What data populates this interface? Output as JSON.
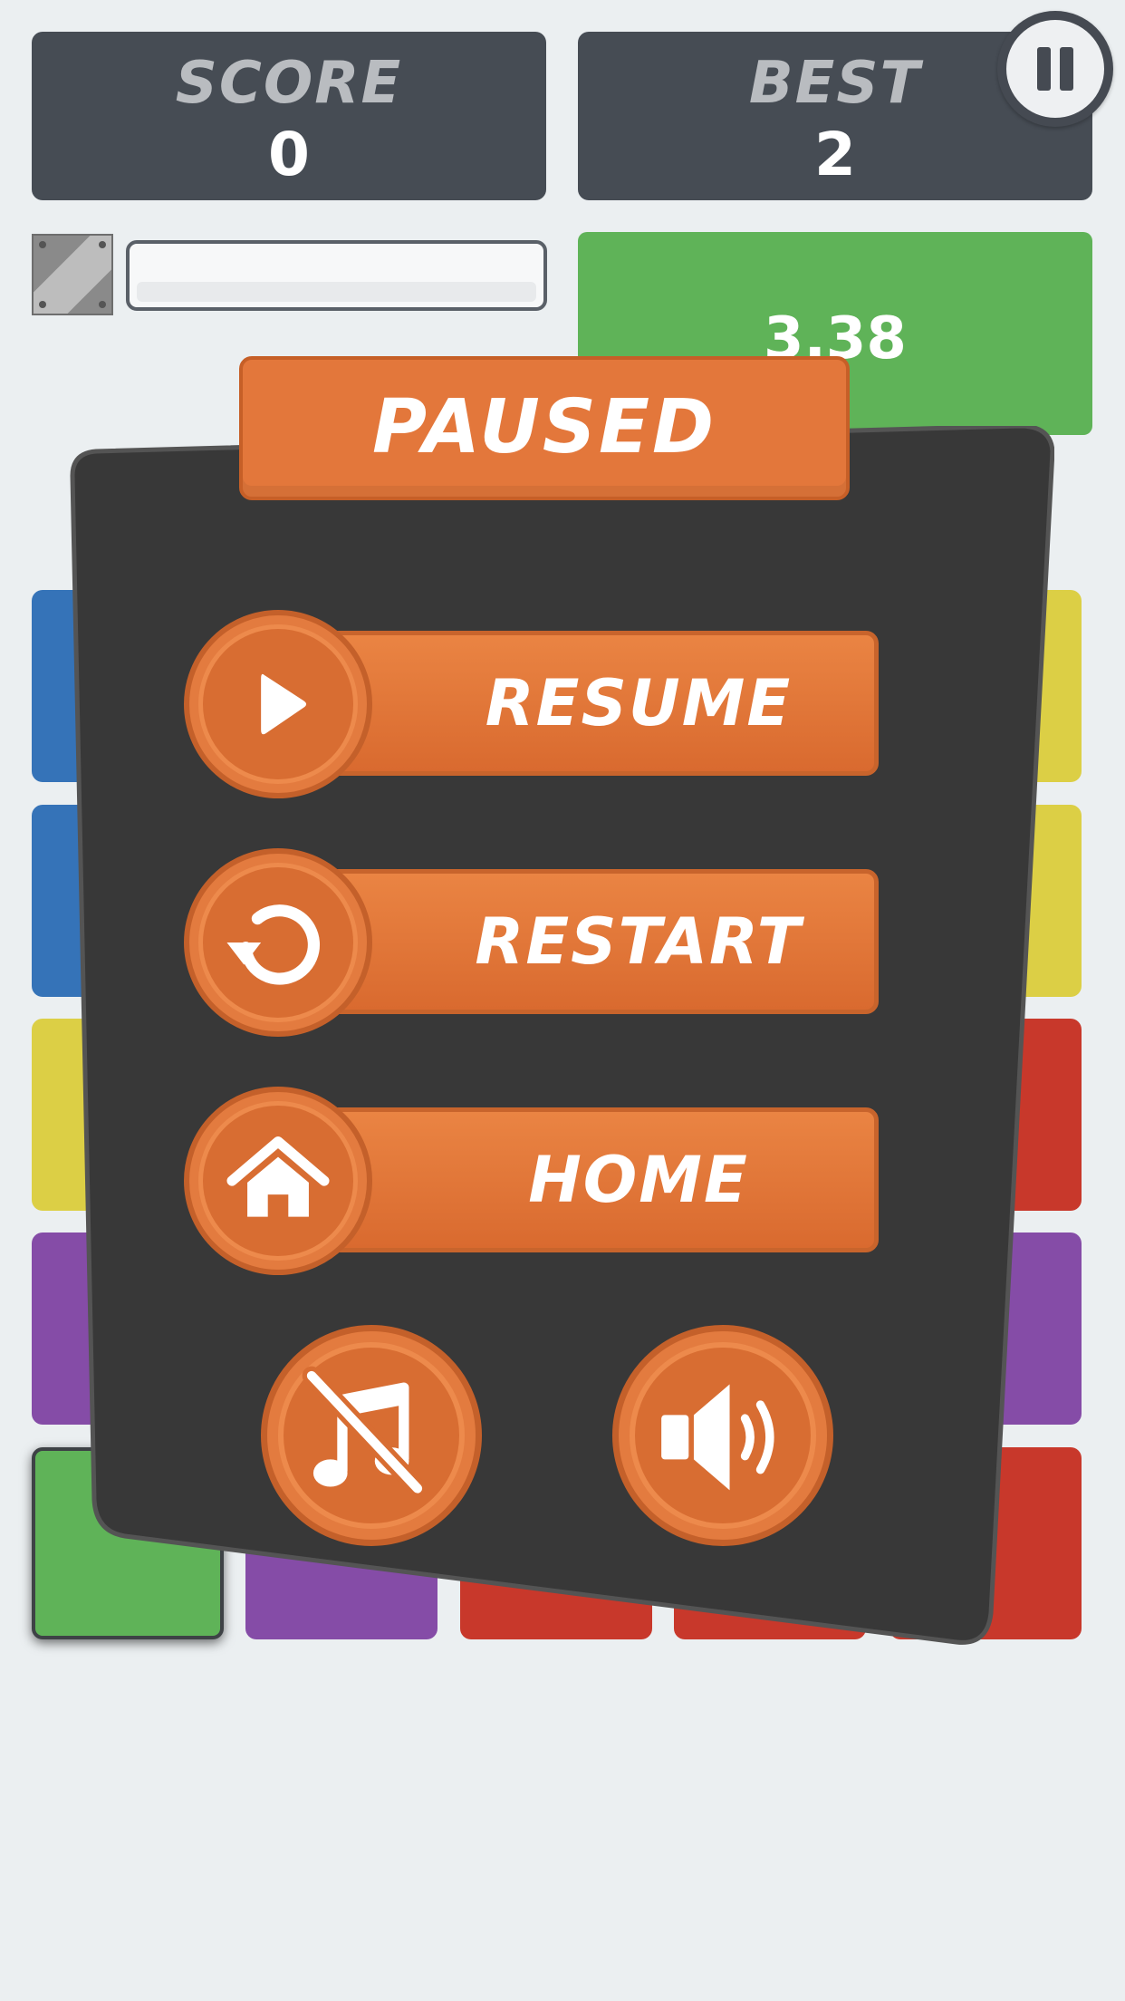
{
  "hud": {
    "score_label": "SCORE",
    "score_value": "0",
    "best_label": "BEST",
    "best_value": "2",
    "timer_value": "3.38"
  },
  "pause_menu": {
    "title": "PAUSED",
    "resume_label": "RESUME",
    "restart_label": "RESTART",
    "home_label": "HOME"
  },
  "icons": {
    "pause": "pause-icon",
    "resume": "play-icon",
    "restart": "restart-icon",
    "home": "home-icon",
    "music": "music-off-icon",
    "sound": "speaker-on-icon",
    "bomb": "striped-bomb-icon"
  },
  "colors": {
    "background": "#ebeff1",
    "hud_box": "#464c54",
    "timer_box": "#5fb358",
    "panel": "#383838",
    "button_orange": "#e47a3e",
    "tile_blue": "#3573b8",
    "tile_yellow": "#dccf45",
    "tile_purple": "#854ca7",
    "tile_red": "#c8382b",
    "tile_green": "#5fb358"
  }
}
